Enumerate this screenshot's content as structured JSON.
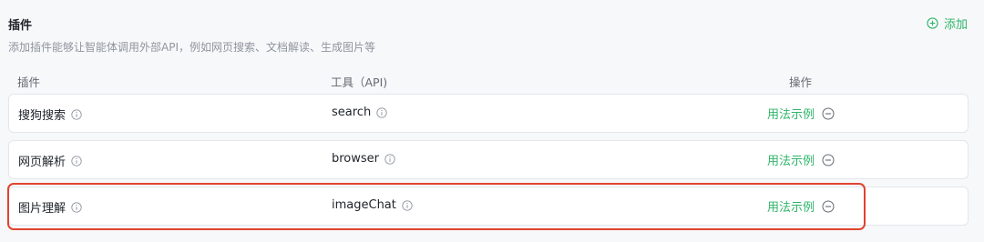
{
  "section": {
    "title": "插件",
    "add_label": "添加",
    "description": "添加插件能够让智能体调用外部API，例如网页搜索、文档解读、生成图片等"
  },
  "table": {
    "headers": {
      "plugin": "插件",
      "tool": "工具（API)",
      "operation": "操作"
    },
    "rows": [
      {
        "plugin": "搜狗搜索",
        "tool": "search",
        "usage_label": "用法示例"
      },
      {
        "plugin": "网页解析",
        "tool": "browser",
        "usage_label": "用法示例"
      },
      {
        "plugin": "图片理解",
        "tool": "imageChat",
        "usage_label": "用法示例"
      }
    ]
  },
  "colors": {
    "accent": "#2fb56a",
    "highlight": "#e0442f"
  },
  "icons": {
    "add": "plus-circle-icon",
    "info": "info-icon",
    "remove": "minus-circle-icon"
  }
}
